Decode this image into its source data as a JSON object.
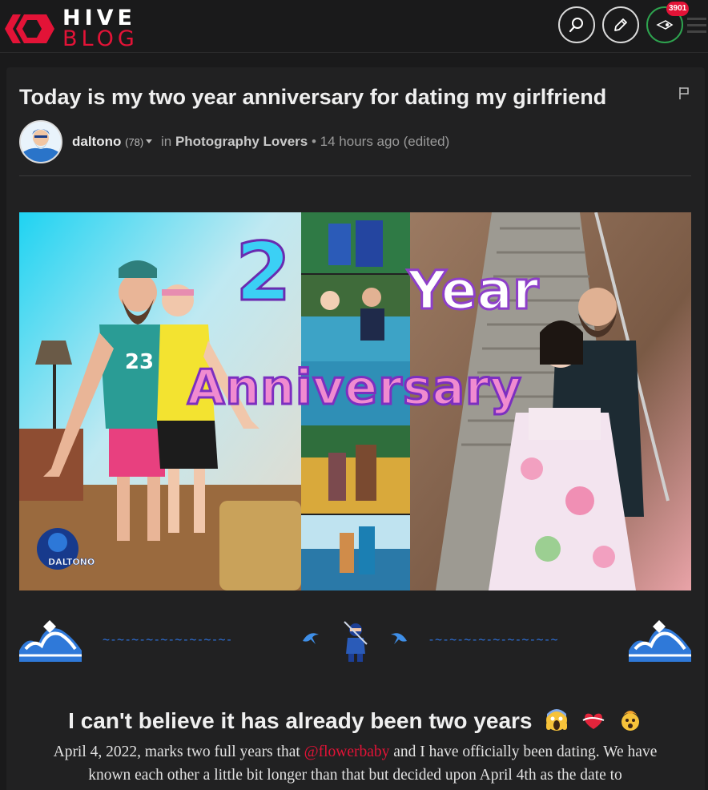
{
  "header": {
    "logo_top": "HIVE",
    "logo_bottom": "BLOG",
    "notification_count": "3901"
  },
  "post": {
    "title": "Today is my two year anniversary for dating my girlfriend",
    "author": "daltono",
    "reputation": "(78)",
    "in_label": "in",
    "community": "Photography Lovers",
    "time": "• 14 hours ago (edited)"
  },
  "hero": {
    "number": "2",
    "word_year": "Year",
    "word_anniversary": "Anniversary",
    "brand": "DALTONO"
  },
  "separator": {
    "left_line": "~-~-~-~-~-~-~-~-~-",
    "right_line": "-~-~-~-~-~-~-~-~-~"
  },
  "body": {
    "heading": "I can't believe it has already been two years",
    "para_line1_before": "April 4, 2022, marks two full years that ",
    "mention": "@flowerbaby",
    "para_line1_after": " and I have officially been dating. We have",
    "para_line2": "known each other a little bit longer than that but decided upon April 4th as the date to"
  }
}
